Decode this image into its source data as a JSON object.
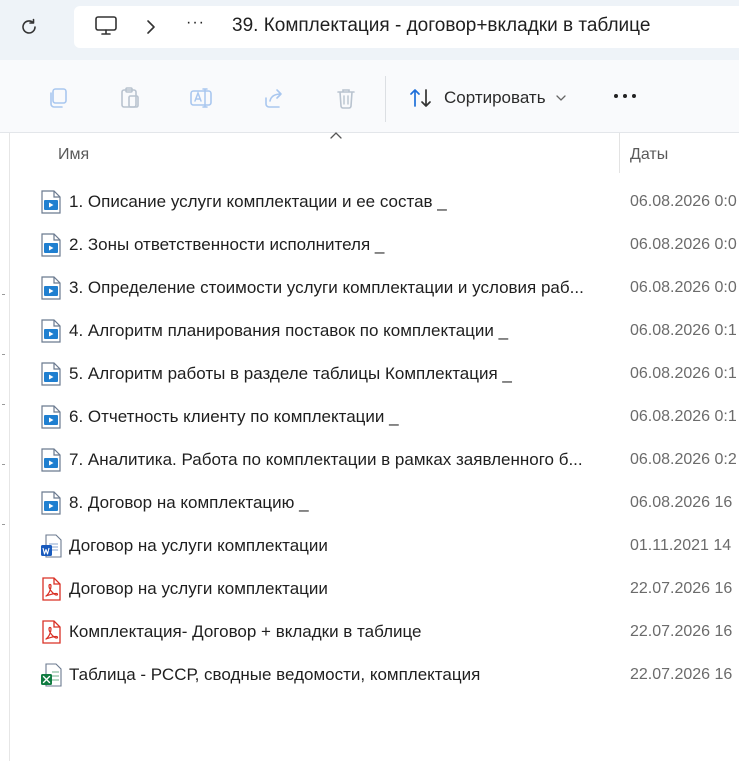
{
  "address": {
    "more_label": "···",
    "current_folder": "39. Комплектация - договор+вкладки в таблице"
  },
  "toolbar": {
    "sort_label": "Сортировать",
    "more_label": "···"
  },
  "columns": {
    "name": "Имя",
    "date": "Даты"
  },
  "files": [
    {
      "name": "1. Описание услуги комплектации и ее состав _",
      "date": "06.08.2026 0:0",
      "type": "video"
    },
    {
      "name": "2. Зоны ответственности исполнителя _",
      "date": "06.08.2026 0:0",
      "type": "video"
    },
    {
      "name": "3. Определение стоимости услуги комплектации и условия раб...",
      "date": "06.08.2026 0:0",
      "type": "video"
    },
    {
      "name": "4. Алгоритм планирования поставок по комплектации _",
      "date": "06.08.2026 0:1",
      "type": "video"
    },
    {
      "name": "5. Алгоритм работы в разделе таблицы Комплектация _",
      "date": "06.08.2026 0:1",
      "type": "video"
    },
    {
      "name": "6. Отчетность клиенту по комплектации _",
      "date": "06.08.2026 0:1",
      "type": "video"
    },
    {
      "name": "7. Аналитика. Работа по комплектации в рамках заявленного б...",
      "date": "06.08.2026 0:2",
      "type": "video"
    },
    {
      "name": "8. Договор на комплектацию _",
      "date": "06.08.2026 16",
      "type": "video"
    },
    {
      "name": "Договор на услуги комплектации",
      "date": "01.11.2021 14",
      "type": "word"
    },
    {
      "name": "Договор на услуги комплектации",
      "date": "22.07.2026 16",
      "type": "pdf"
    },
    {
      "name": "Комплектация- Договор + вкладки в таблице",
      "date": "22.07.2026 16",
      "type": "pdf"
    },
    {
      "name": "Таблица - РССР, сводные ведомости, комплектация",
      "date": "22.07.2026 16",
      "type": "excel"
    }
  ],
  "colors": {
    "accent": "#1e6fd9",
    "pdf": "#d93025",
    "word": "#185abd",
    "excel": "#107c41"
  }
}
